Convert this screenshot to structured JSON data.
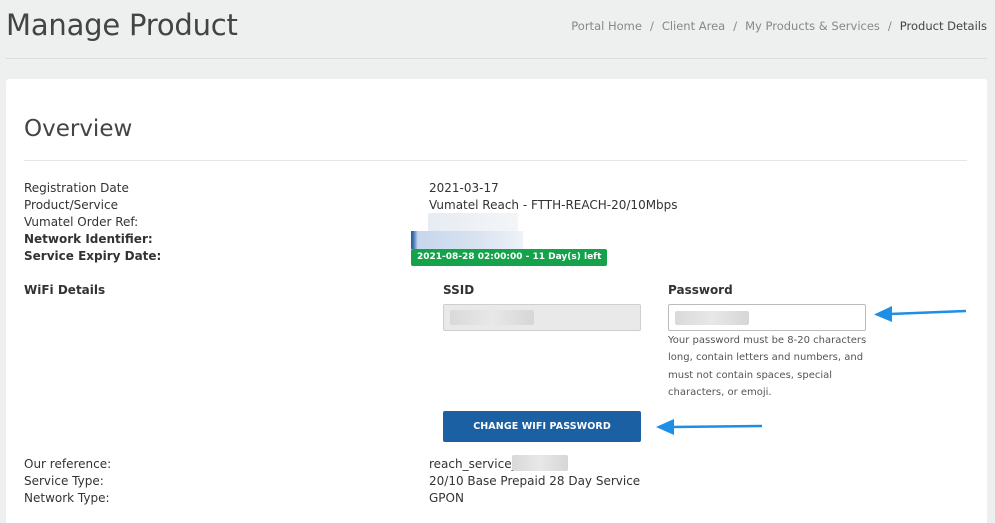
{
  "header": {
    "title": "Manage Product",
    "breadcrumb": [
      "Portal Home",
      "Client Area",
      "My Products & Services",
      "Product Details"
    ],
    "separator": "/"
  },
  "overview": {
    "title": "Overview",
    "rows": [
      {
        "label": "Registration Date",
        "value": "2021-03-17"
      },
      {
        "label": "Product/Service",
        "value": "Vumatel Reach - FTTH-REACH-20/10Mbps"
      },
      {
        "label": "Vumatel Order Ref:",
        "value": ""
      },
      {
        "label": "Network Identifier:",
        "value": ""
      },
      {
        "label": "Service Expiry Date:",
        "value": ""
      }
    ],
    "expiry_badge": "2021-08-28 02:00:00 - 11 Day(s) left"
  },
  "wifi": {
    "label": "WiFi Details",
    "ssid_label": "SSID",
    "password_label": "Password",
    "password_help": "Your password must be 8-20 characters long, contain letters and numbers, and must not contain spaces, special characters, or emoji.",
    "change_button": "CHANGE WIFI PASSWORD"
  },
  "details": [
    {
      "label": "Our reference:",
      "value": "reach_service_"
    },
    {
      "label": "Service Type:",
      "value": "20/10 Base Prepaid 28 Day Service"
    },
    {
      "label": "Network Type:",
      "value": "GPON"
    }
  ],
  "colors": {
    "accent_button": "#1b60a2",
    "expiry_badge": "#14a34a",
    "annotation_arrow": "#1e8fe6"
  }
}
